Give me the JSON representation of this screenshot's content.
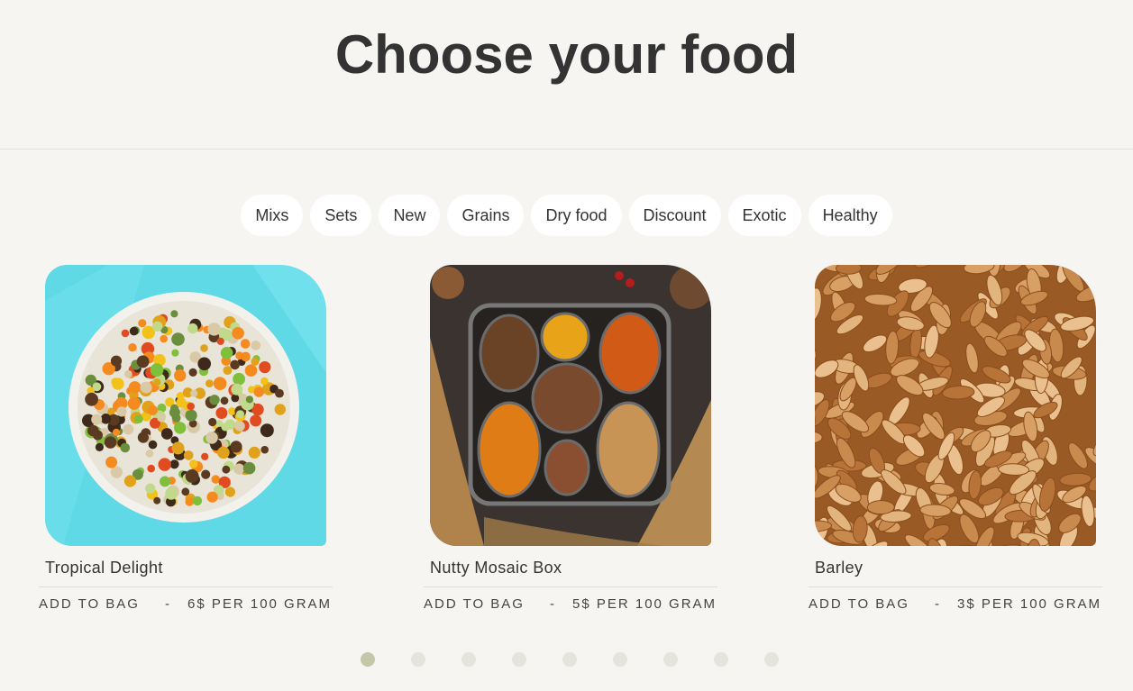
{
  "header": {
    "title": "Choose your food"
  },
  "filters": [
    {
      "label": "Mixs"
    },
    {
      "label": "Sets"
    },
    {
      "label": "New"
    },
    {
      "label": "Grains"
    },
    {
      "label": "Dry food"
    },
    {
      "label": "Discount"
    },
    {
      "label": "Exotic"
    },
    {
      "label": "Healthy"
    }
  ],
  "products": [
    {
      "name": "Tropical Delight",
      "add_label": "ADD TO BAG",
      "separator": "-",
      "price": "6$ PER 100 GRAM"
    },
    {
      "name": "Nutty Mosaic Box",
      "add_label": "ADD TO BAG",
      "separator": "-",
      "price": "5$ PER 100 GRAM"
    },
    {
      "name": "Barley",
      "add_label": "ADD TO BAG",
      "separator": "-",
      "price": "3$ PER 100 GRAM"
    }
  ],
  "carousel": {
    "dot_count": 9,
    "active_index": 0
  },
  "colors": {
    "background": "#f6f5f2",
    "chip_background": "#ffffff",
    "text": "#333333",
    "dot_active": "#c4c7a8",
    "dot_inactive": "#e4e3dc"
  }
}
